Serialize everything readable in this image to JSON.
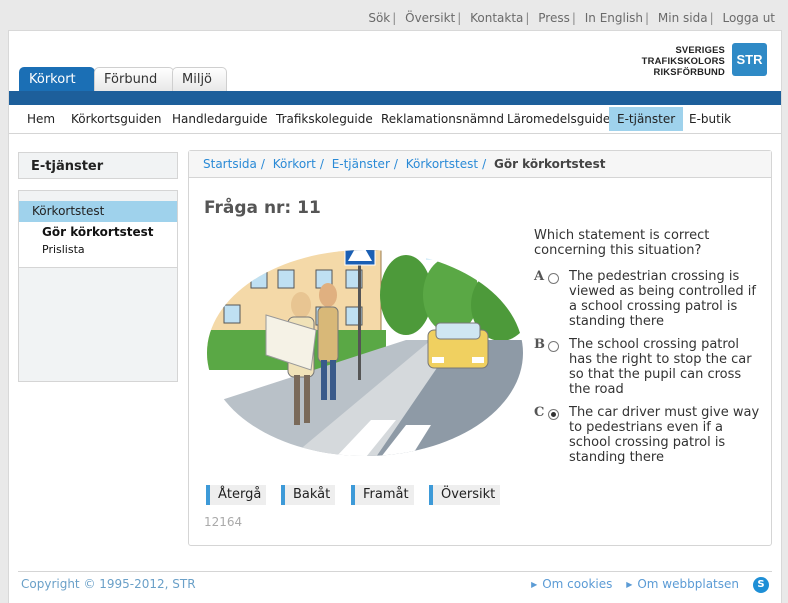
{
  "top_links": [
    "Sök",
    "Översikt",
    "Kontakta",
    "Press",
    "In English",
    "Min sida",
    "Logga ut"
  ],
  "logo": {
    "line1": "SVERIGES",
    "line2": "TRAFIKSKOLORS",
    "line3": "RIKSFÖRBUND",
    "badge": "STR"
  },
  "tabs": [
    "Körkort",
    "Förbund",
    "Miljö"
  ],
  "main_menu": [
    "Hem",
    "Körkortsguiden",
    "Handledarguide",
    "Trafikskoleguide",
    "Reklamationsnämnd",
    "Läromedelsguide",
    "E-tjänster",
    "E-butik"
  ],
  "sidebar": {
    "heading": "E-tjänster",
    "active_item": "Körkortstest",
    "sub_items": [
      "Gör körkortstest",
      "Prislista"
    ]
  },
  "breadcrumb": {
    "items": [
      "Startsida",
      "Körkort",
      "E-tjänster",
      "Körkortstest"
    ],
    "current": "Gör körkortstest"
  },
  "question": {
    "title": "Fråga nr: 11",
    "text": "Which statement is correct concerning this situation?",
    "options": [
      {
        "letter": "A",
        "text": "The pedestrian crossing is viewed as being controlled if a school crossing patrol is standing there",
        "checked": false
      },
      {
        "letter": "B",
        "text": "The school crossing patrol has the right to stop the car so that the pupil can cross the road",
        "checked": false
      },
      {
        "letter": "C",
        "text": "The car driver must give way to pedestrians even if a school crossing patrol is standing there",
        "checked": true
      }
    ],
    "id": "12164"
  },
  "nav_buttons": [
    "Återgå",
    "Bakåt",
    "Framåt",
    "Översikt"
  ],
  "footer": {
    "copyright": "Copyright © 1995-2012, STR",
    "links": [
      "Om cookies",
      "Om webbplatsen"
    ]
  },
  "colors": {
    "brand_blue": "#1d5f9b",
    "tab_active": "#1b6fb5",
    "menu_highlight": "#9fd2ec",
    "link": "#2a8ad6"
  }
}
